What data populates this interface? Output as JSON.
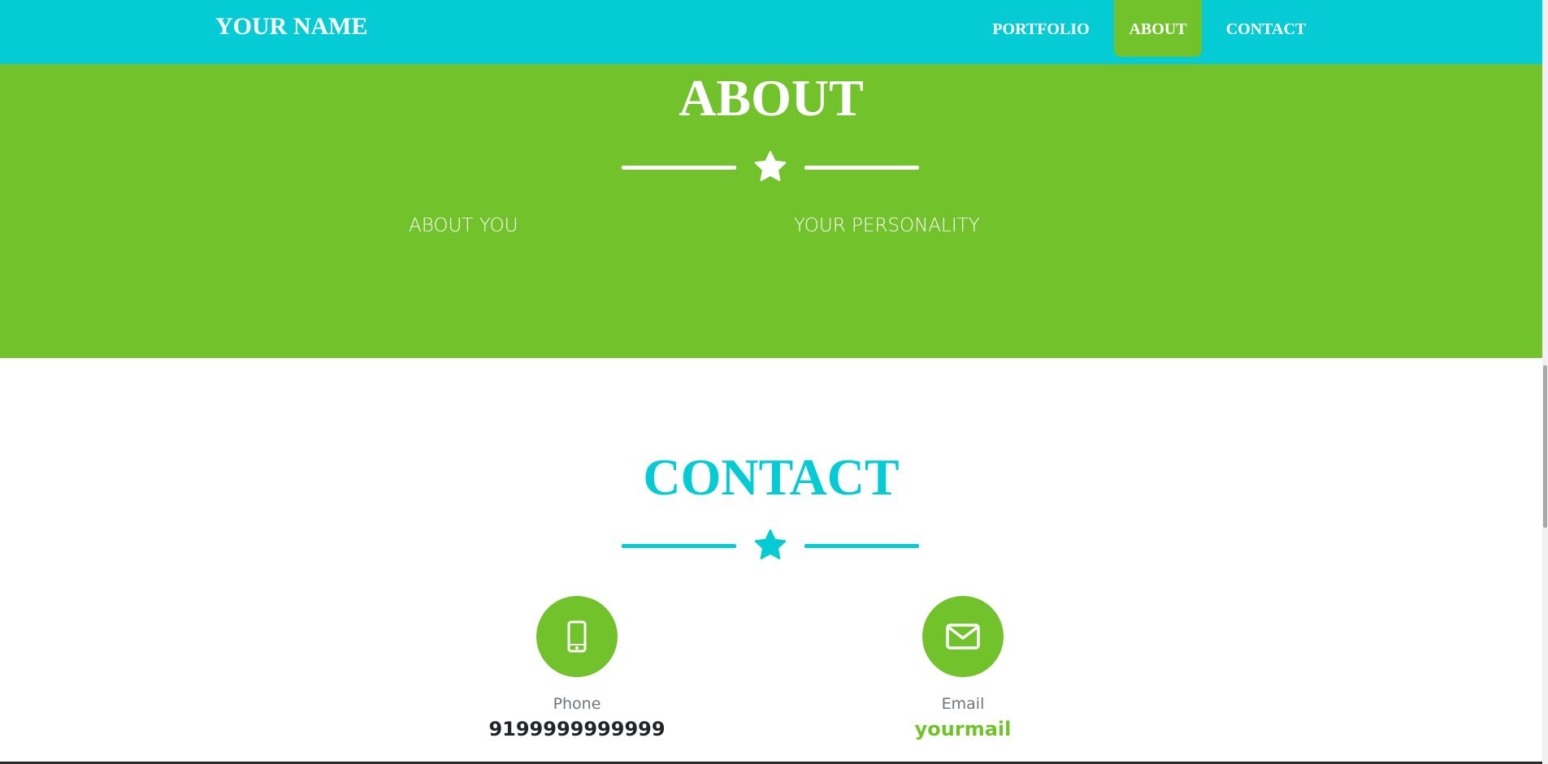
{
  "navbar": {
    "brand": "YOUR NAME",
    "items": [
      {
        "label": "PORTFOLIO",
        "active": false
      },
      {
        "label": "ABOUT",
        "active": true
      },
      {
        "label": "CONTACT",
        "active": false
      }
    ]
  },
  "about": {
    "title": "ABOUT",
    "left_text": "ABOUT YOU",
    "right_text": "YOUR PERSONALITY"
  },
  "contact": {
    "title": "CONTACT",
    "phone": {
      "label": "Phone",
      "value": "9199999999999",
      "icon": "mobile-phone-icon"
    },
    "email": {
      "label": "Email",
      "value": "yourmail",
      "icon": "envelope-icon"
    }
  },
  "colors": {
    "primary_cyan": "#05ccd4",
    "accent_green": "#71c22b",
    "text_dark": "#212529",
    "text_muted": "#6c757d"
  }
}
